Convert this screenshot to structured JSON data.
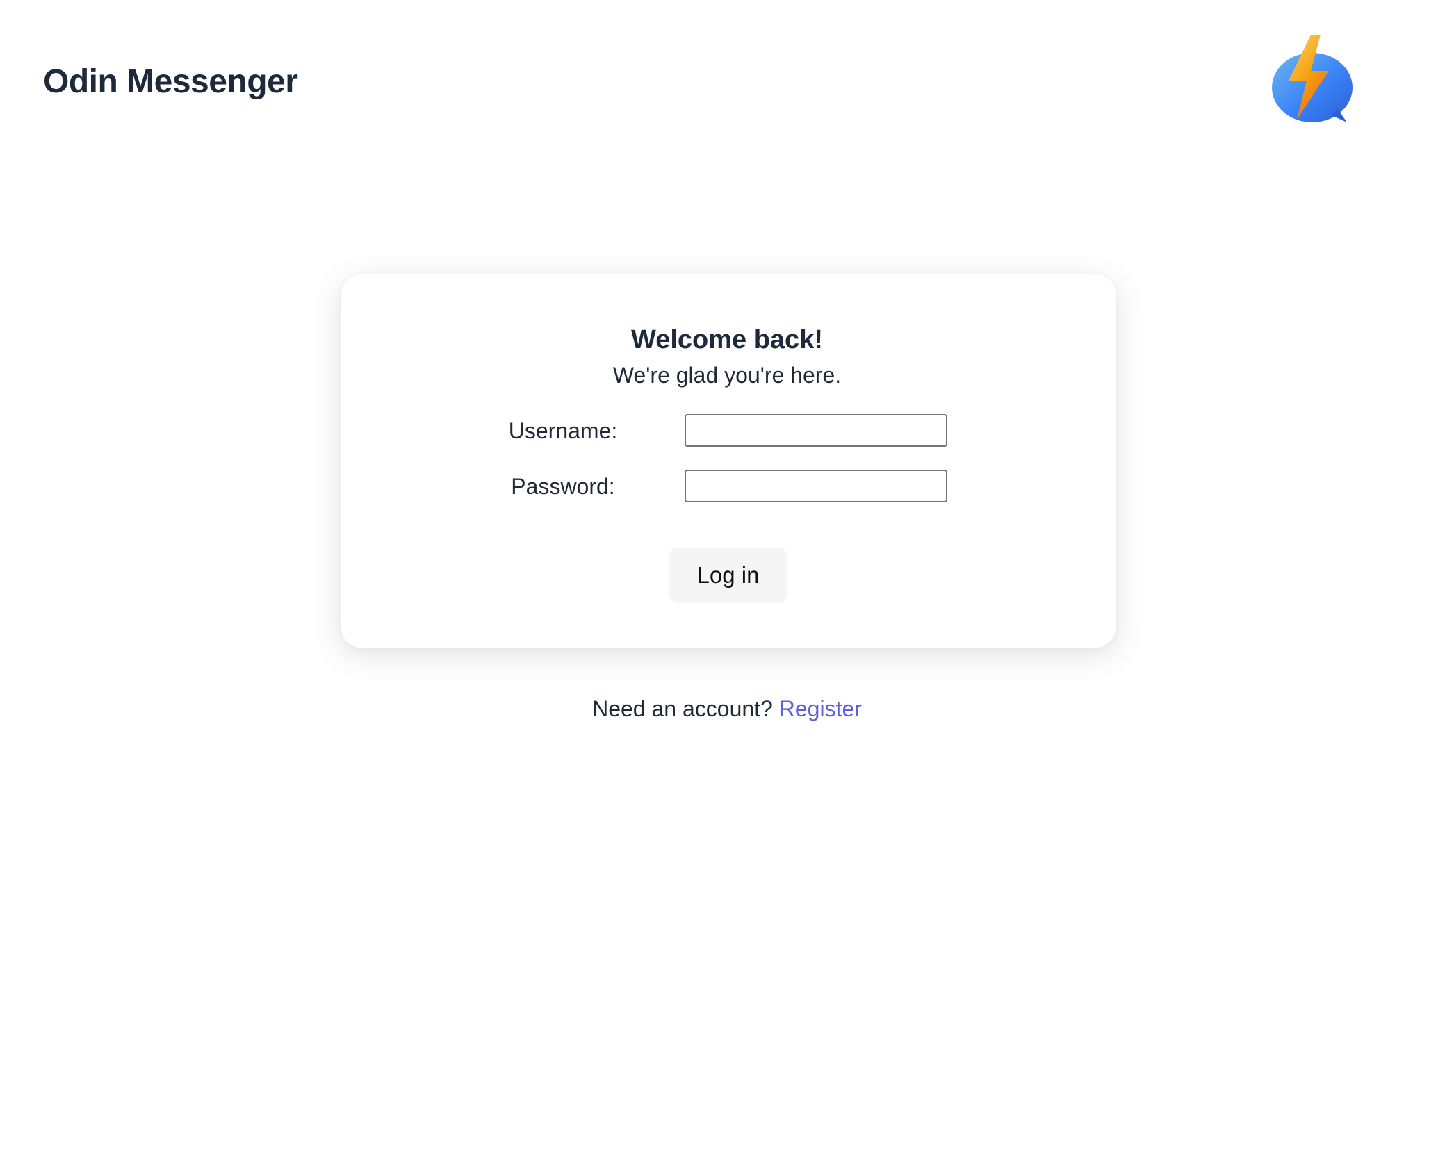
{
  "app": {
    "title": "Odin Messenger",
    "logo_icon": "lightning-chat-bubble-icon"
  },
  "login_card": {
    "heading": "Welcome back!",
    "subheading": "We're glad you're here.",
    "username_label": "Username:",
    "username_value": "",
    "password_label": "Password:",
    "password_value": "",
    "submit_label": "Log in"
  },
  "footer": {
    "prompt": "Need an account?",
    "register_label": "Register"
  },
  "colors": {
    "link": "#5b5fe0",
    "text": "#1e293b",
    "button_bg": "#f5f5f5",
    "logo_blue": "#3b82f6",
    "logo_orange": "#f59e0b"
  }
}
